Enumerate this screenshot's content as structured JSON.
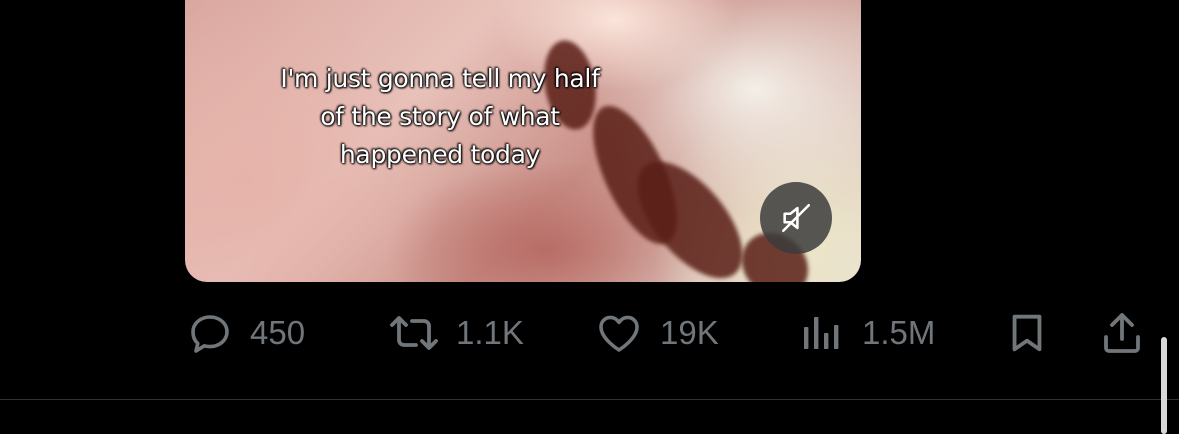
{
  "video": {
    "caption_lines": [
      "I'm just gonna tell my half",
      "of the story of what",
      "happened today"
    ],
    "mute_icon": "speaker-muted-icon"
  },
  "actions": {
    "reply": {
      "icon": "reply-icon",
      "count": "450"
    },
    "repost": {
      "icon": "repost-icon",
      "count": "1.1K"
    },
    "like": {
      "icon": "heart-icon",
      "count": "19K"
    },
    "views": {
      "icon": "views-chart-icon",
      "count": "1.5M"
    },
    "bookmark": {
      "icon": "bookmark-icon"
    },
    "share": {
      "icon": "share-icon"
    }
  },
  "colors": {
    "background": "#000000",
    "icon_gray": "#71767b",
    "divider": "#2f3336"
  }
}
